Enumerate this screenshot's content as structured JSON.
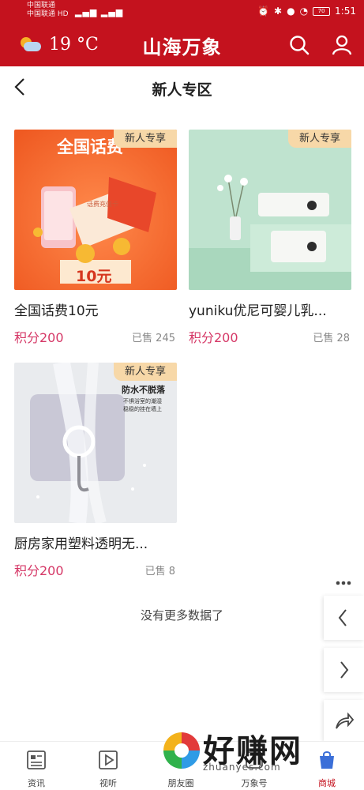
{
  "status": {
    "carrier_line1": "中国联通",
    "carrier_line2": "中国联通 HD",
    "time": "1:51",
    "battery": "70"
  },
  "header": {
    "temperature": "19 °C",
    "app_title": "山海万象"
  },
  "page": {
    "title": "新人专区"
  },
  "products": [
    {
      "tag": "新人专享",
      "name": "全国话费10元",
      "price": "积分200",
      "sold": "已售 245",
      "art": {
        "headline": "全国话费",
        "subtitle": "话费充值卡",
        "amount": "10元"
      }
    },
    {
      "tag": "新人专享",
      "name": "yuniku优尼可婴儿乳...",
      "price": "积分200",
      "sold": "已售 28"
    },
    {
      "tag": "新人专享",
      "name": "厨房家用塑料透明无...",
      "price": "积分200",
      "sold": "已售 8",
      "art": {
        "headline": "防水不脱落",
        "line1": "不惧浴室的潮湿",
        "line2": "稳稳的挂在墙上"
      }
    }
  ],
  "footer_note": "没有更多数据了",
  "side_actions": [
    "more-icon",
    "back-arrow-icon",
    "forward-arrow-icon",
    "share-icon"
  ],
  "bottom_nav": [
    {
      "label": "资讯",
      "icon": "news-icon"
    },
    {
      "label": "视听",
      "icon": "play-icon"
    },
    {
      "label": "朋友圈",
      "icon": "moments-icon"
    },
    {
      "label": "万象号",
      "icon": "account-icon"
    },
    {
      "label": "商城",
      "icon": "mall-icon",
      "active": true
    }
  ],
  "watermark": {
    "text": "好赚网",
    "url": "zhuanyes.com"
  },
  "colors": {
    "brand_red": "#c4121e",
    "price_pink": "#d53766",
    "tag_bg": "#f7d8a8"
  }
}
